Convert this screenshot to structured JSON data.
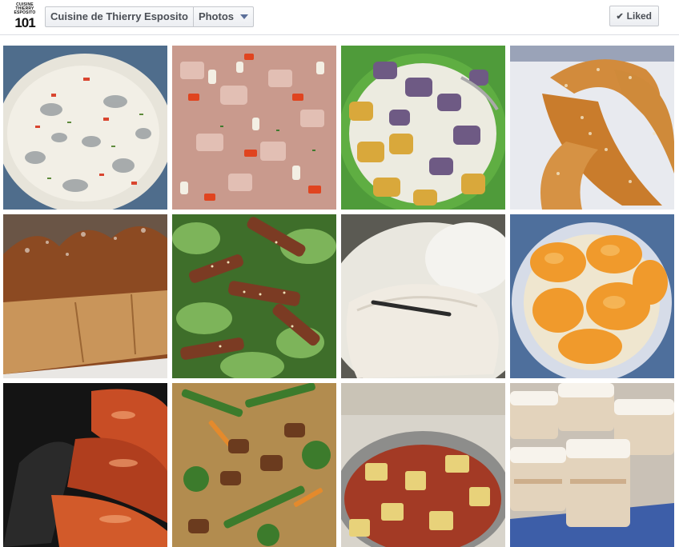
{
  "page": {
    "logo_text_line1": "CUISINE",
    "logo_text_line2": "THIERRY",
    "logo_text_line3": "ESPOSITO",
    "logo_number": "101",
    "name": "Cuisine de Thierry Esposito",
    "section": "Photos",
    "like_label": "Liked"
  },
  "photos": [
    {
      "name": "photo-shrimp-cream-soup"
    },
    {
      "name": "photo-chopped-meat-salad"
    },
    {
      "name": "photo-purple-yam-dessert"
    },
    {
      "name": "photo-sugar-twist-donuts"
    },
    {
      "name": "photo-brioche-loaf"
    },
    {
      "name": "photo-sesame-beef-salad"
    },
    {
      "name": "photo-vanilla-fish-rice"
    },
    {
      "name": "photo-papaya-dessert"
    },
    {
      "name": "photo-glazed-chicken"
    },
    {
      "name": "photo-stir-fry-vegetables"
    },
    {
      "name": "photo-corned-beef-potatoes"
    },
    {
      "name": "photo-coconut-cake-squares"
    }
  ],
  "colors": {
    "topbar_border": "#dcdee3",
    "button_text": "#4b4f56",
    "caret": "#5b6f9a"
  }
}
